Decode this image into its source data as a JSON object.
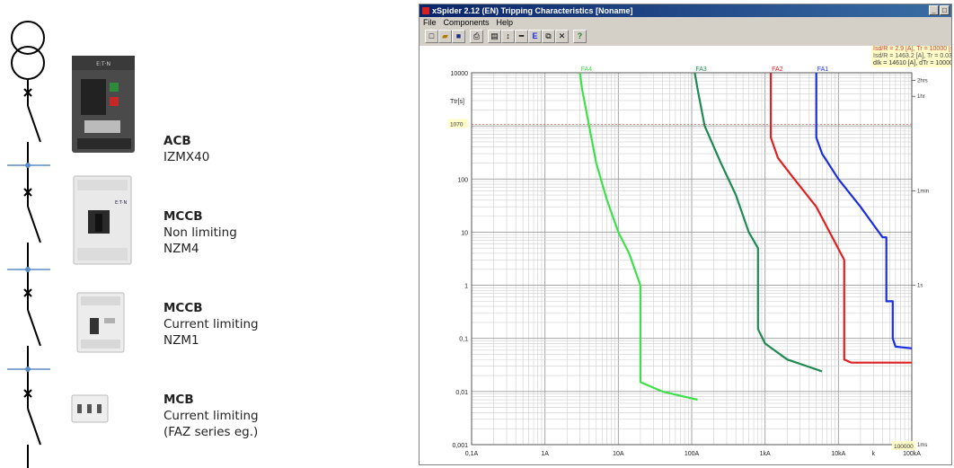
{
  "devices": [
    {
      "type": "ACB",
      "lines": [
        "IZMX40"
      ]
    },
    {
      "type": "MCCB",
      "lines": [
        "Non limiting",
        "NZM4"
      ]
    },
    {
      "type": "MCCB",
      "lines": [
        "Current limiting",
        "NZM1"
      ]
    },
    {
      "type": "MCB",
      "lines": [
        "Current limiting",
        "(FAZ series eg.)"
      ]
    }
  ],
  "device_images": [
    {
      "icon": "acb-breaker-photo",
      "brand": "E:T·N"
    },
    {
      "icon": "mccb-nzm4-photo",
      "brand": "E:T·N"
    },
    {
      "icon": "mccb-nzm1-photo"
    },
    {
      "icon": "mcb-faz-photo"
    }
  ],
  "window": {
    "title": "xSpider 2.12 (EN) Tripping Characteristics [Noname]",
    "menu": [
      "File",
      "Components",
      "Help"
    ],
    "title_buttons": [
      "minimize",
      "maximize"
    ],
    "toolbar_icons": [
      "new-icon",
      "open-icon",
      "save-icon",
      "print-icon",
      "preview-icon",
      "cursor-icon",
      "line-icon",
      "edit-icon",
      "copy-icon",
      "delete-icon",
      "help-icon"
    ],
    "toolbar_glyphs": [
      "□",
      "▰",
      "■",
      "⎙",
      "▤",
      "↕",
      "━",
      "E",
      "⧉",
      "✕",
      "?"
    ],
    "readout": [
      {
        "text": "Isd/R = 2.9 [A], Tr = 10000 [s]",
        "color": "#d63a3a"
      },
      {
        "text": "Isd/R = 1463.2 [A], Tr = 0.035 [",
        "color": "#555555"
      },
      {
        "text": "dIk = 14610 [A], dTr = 10000 [",
        "color": "#333333"
      }
    ],
    "cursor_time_label": "1070",
    "cursor_current_label": "100000"
  },
  "chart_data": {
    "type": "line",
    "x_scale": "log",
    "y_scale": "log",
    "xlim": [
      0.1,
      100000
    ],
    "ylim": [
      0.001,
      10000
    ],
    "x_tick_labels": [
      {
        "v": 0.1,
        "label": "0,1A"
      },
      {
        "v": 1,
        "label": "1A"
      },
      {
        "v": 10,
        "label": "10A"
      },
      {
        "v": 100,
        "label": "100A"
      },
      {
        "v": 1000,
        "label": "1kA"
      },
      {
        "v": 10000,
        "label": "10kA"
      },
      {
        "v": 30000,
        "label": "k"
      },
      {
        "v": 100000,
        "label": "100kA"
      }
    ],
    "y_tick_labels": [
      {
        "v": 10000,
        "label": "10000"
      },
      {
        "v": 100,
        "label": "100"
      },
      {
        "v": 10,
        "label": "10"
      },
      {
        "v": 1,
        "label": "1"
      },
      {
        "v": 0.1,
        "label": "0,1"
      },
      {
        "v": 0.01,
        "label": "0,01"
      },
      {
        "v": 0.001,
        "label": "0,001"
      }
    ],
    "ylabel": "Ttr[s]",
    "right_labels": [
      {
        "v": 7200,
        "label": "2hrs"
      },
      {
        "v": 3600,
        "label": "1hr"
      },
      {
        "v": 60,
        "label": "1min"
      },
      {
        "v": 1,
        "label": "1s"
      },
      {
        "v": 0.001,
        "label": "1ms"
      }
    ],
    "grid": true,
    "reference_line_y": 1070,
    "series": [
      {
        "name": "FA1",
        "color": "#1a2ee0",
        "points": [
          [
            5000,
            10000
          ],
          [
            5000,
            600
          ],
          [
            6000,
            300
          ],
          [
            10000,
            100
          ],
          [
            20000,
            30
          ],
          [
            40000,
            8
          ],
          [
            45000,
            8
          ],
          [
            45000,
            0.5
          ],
          [
            55000,
            0.5
          ],
          [
            55000,
            0.1
          ],
          [
            60000,
            0.07
          ],
          [
            100000,
            0.065
          ]
        ]
      },
      {
        "name": "FA2",
        "color": "#e02020",
        "points": [
          [
            1200,
            10000
          ],
          [
            1200,
            600
          ],
          [
            1500,
            250
          ],
          [
            2500,
            100
          ],
          [
            5000,
            30
          ],
          [
            12000,
            3
          ],
          [
            12000,
            0.04
          ],
          [
            15000,
            0.035
          ],
          [
            100000,
            0.035
          ]
        ]
      },
      {
        "name": "FA3",
        "color": "#1e8a52",
        "points": [
          [
            110,
            10000
          ],
          [
            120,
            5000
          ],
          [
            150,
            1000
          ],
          [
            250,
            200
          ],
          [
            400,
            50
          ],
          [
            600,
            10
          ],
          [
            800,
            5
          ],
          [
            800,
            0.15
          ],
          [
            1000,
            0.08
          ],
          [
            2000,
            0.04
          ],
          [
            6000,
            0.024
          ]
        ]
      },
      {
        "name": "FA4",
        "color": "#3de04a",
        "points": [
          [
            3,
            10000
          ],
          [
            3.2,
            5000
          ],
          [
            4,
            1000
          ],
          [
            5,
            200
          ],
          [
            7,
            40
          ],
          [
            10,
            10
          ],
          [
            14,
            4
          ],
          [
            20,
            1
          ],
          [
            20,
            0.015
          ],
          [
            40,
            0.01
          ],
          [
            120,
            0.007
          ]
        ]
      }
    ]
  }
}
